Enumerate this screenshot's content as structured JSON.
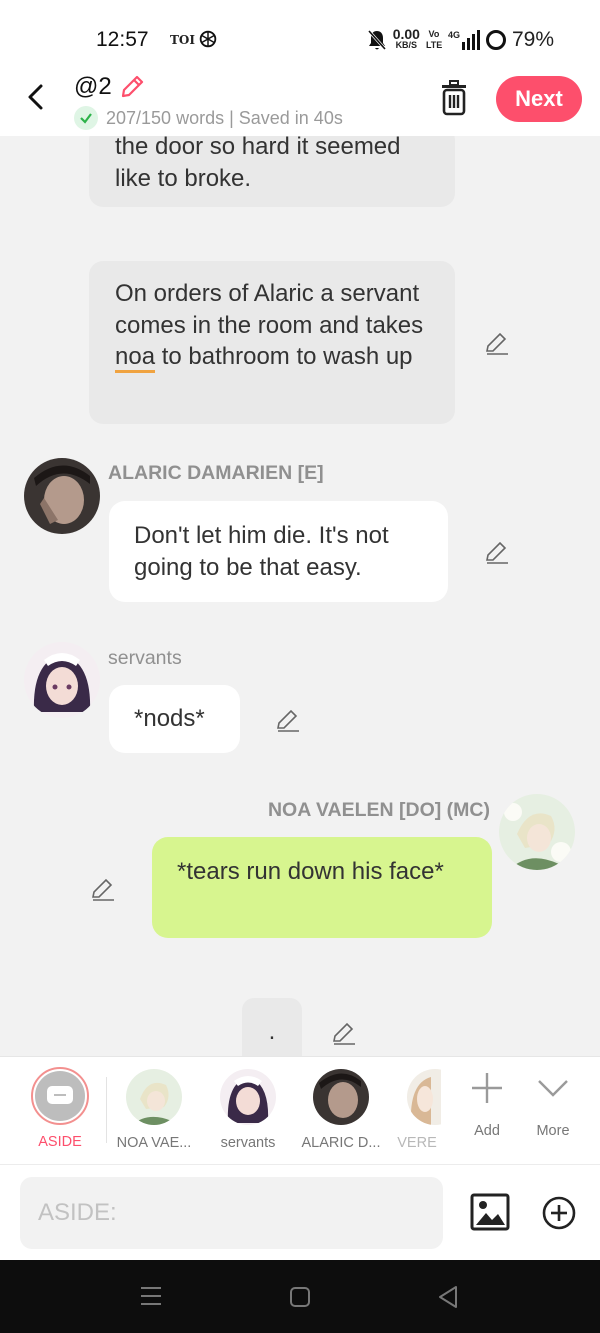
{
  "status_bar": {
    "time": "12:57",
    "app_label": "TOI",
    "net_speed": "0.00",
    "net_unit": "KB/S",
    "volte": "Vo LTE",
    "signal": "4G",
    "battery": "79%"
  },
  "header": {
    "title": "@2",
    "word_status": "207/150 words | Saved in 40s",
    "next_label": "Next"
  },
  "messages": {
    "narration1": "the door so hard it seemed like to broke.",
    "narration2_a": "On orders of Alaric a servant comes in the room and takes ",
    "narration2_u": "noa",
    "narration2_b": " to bathroom to wash up",
    "alaric_name": "ALARIC DAMARIEN [E]",
    "alaric_text": "Don't let him die. It's not going to be that easy.",
    "servants_name": "servants",
    "servants_text": "*nods*",
    "noa_name": "NOA VAELEN [DO] (MC)",
    "noa_text": "*tears run down his face*",
    "dot_text": "."
  },
  "characters": {
    "aside": "ASIDE",
    "noa": "NOA VAE...",
    "servants": "servants",
    "alaric": "ALARIC D...",
    "vere": "VERE",
    "add": "Add",
    "more": "More"
  },
  "input": {
    "placeholder": "ASIDE:"
  },
  "colors": {
    "accent": "#fd4f6c",
    "mc_bubble": "#d7f58f",
    "narration_bubble": "#e9e9e9",
    "aside_ring": "#f3908f"
  }
}
